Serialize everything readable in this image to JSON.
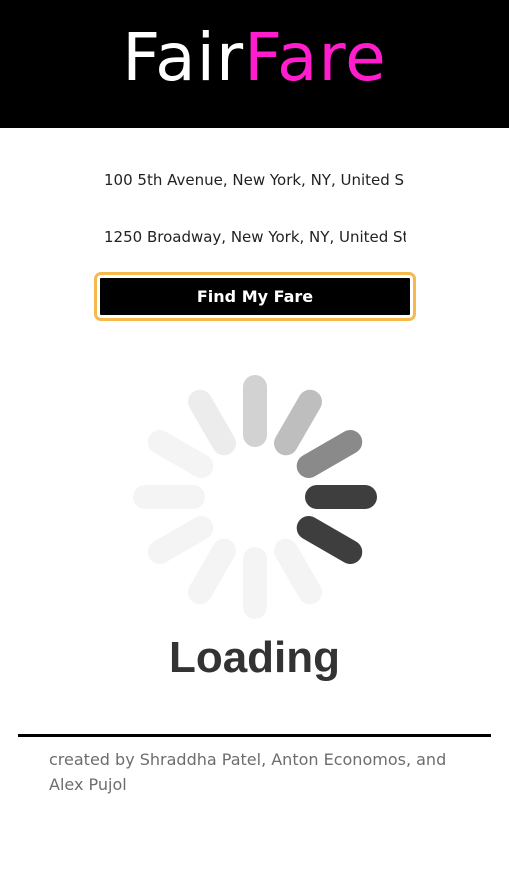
{
  "colors": {
    "header_bg": "#000000",
    "accent": "#ff1dce",
    "button_focus": "#f5b94e"
  },
  "header": {
    "logo_part1": "Fair",
    "logo_part2": "Fare"
  },
  "form": {
    "origin_value": "100 5th Avenue, New York, NY, United S",
    "destination_value": "1250 Broadway, New York, NY, United St",
    "submit_label": "Find My Fare"
  },
  "loader": {
    "icon": "spinner-icon",
    "label": "Loading"
  },
  "footer": {
    "credits": "created by Shraddha Patel, Anton Economos, and Alex Pujol"
  }
}
